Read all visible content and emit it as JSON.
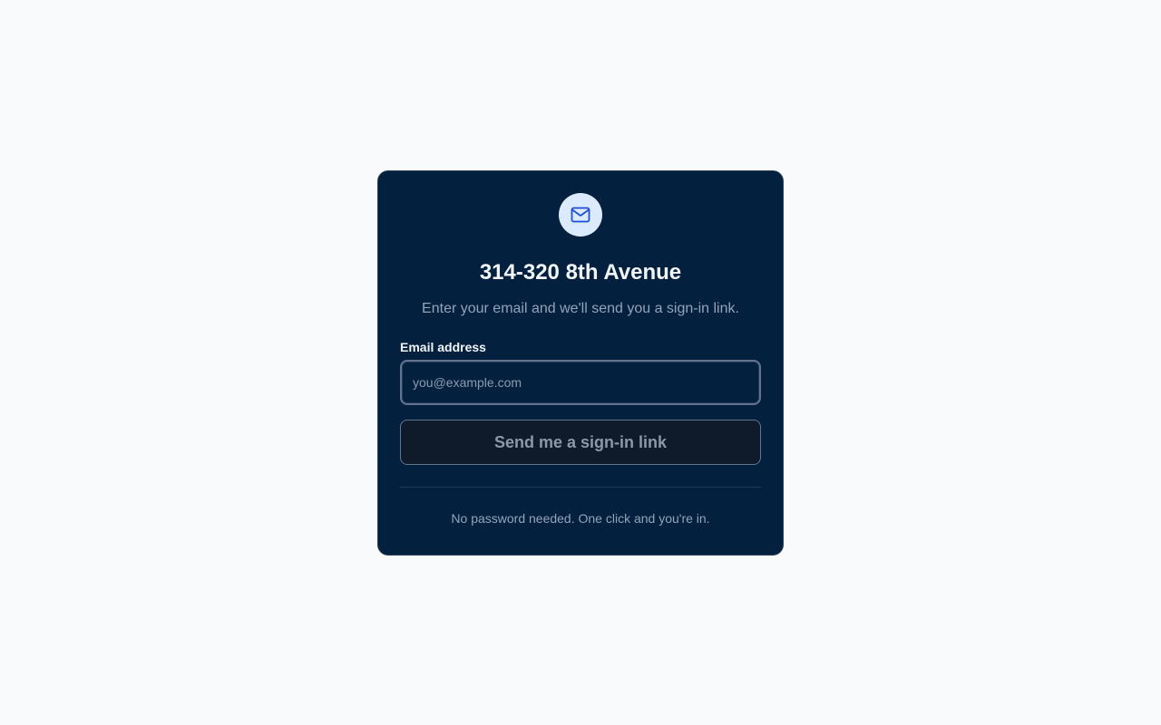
{
  "colors": {
    "page_background": "#f8fafc",
    "card_background": "#03203e",
    "icon_circle": "#dbeafe",
    "icon_stroke": "#1d4ed8",
    "title_text": "#f1f5f9",
    "muted_text": "#94a3b8",
    "button_background": "#0f1b2a",
    "button_text": "#8b98a9"
  },
  "card": {
    "icon": "mail-icon",
    "title": "314-320 8th Avenue",
    "subtitle": "Enter your email and we'll send you a sign-in link."
  },
  "form": {
    "email_label": "Email address",
    "email_value": "",
    "email_placeholder": "you@example.com",
    "submit_label": "Send me a sign-in link"
  },
  "footer": {
    "note": "No password needed. One click and you're in."
  }
}
